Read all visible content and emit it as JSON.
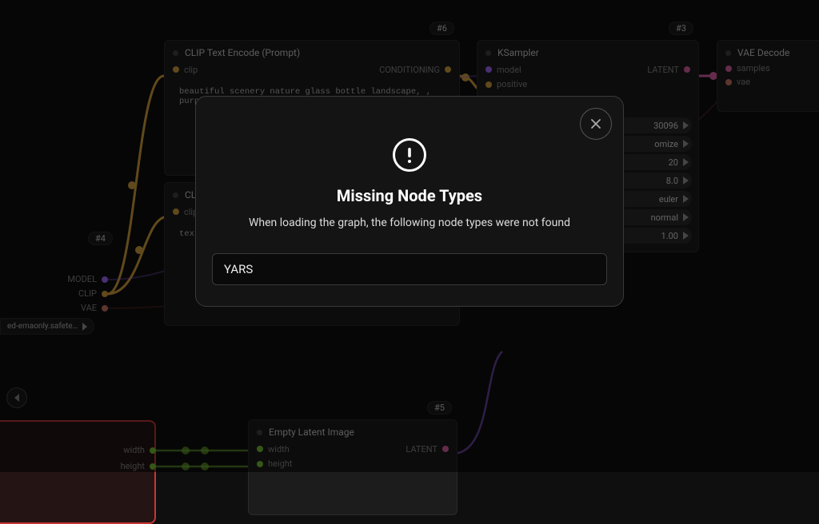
{
  "modal": {
    "title": "Missing Node Types",
    "subtitle": "When loading the graph, the following node types were not found",
    "entry": "YARS"
  },
  "nodes": {
    "clip1": {
      "id": "#6",
      "title": "CLIP Text Encode (Prompt)",
      "input_label": "clip",
      "output_label": "CONDITIONING",
      "text": "beautiful scenery nature glass bottle landscape, , purple galaxy bottle,"
    },
    "clip2": {
      "title": "CLIP Te",
      "input_label": "clip",
      "text": "text, waterm"
    },
    "ksampler": {
      "id": "#3",
      "title": "KSampler",
      "output_label": "LATENT",
      "in_model": "model",
      "in_positive": "positive",
      "params": {
        "seed_k": "",
        "seed_v": "30096",
        "ctrl_k": "",
        "ctrl_v": "omize",
        "steps_k": "",
        "steps_v": "20",
        "cfg_k": "",
        "cfg_v": "8.0",
        "sampler_k": "",
        "sampler_v": "euler",
        "sched_k": "",
        "sched_v": "normal",
        "denoise_k": "",
        "denoise_v": "1.00"
      }
    },
    "vae_decode": {
      "title": "VAE Decode",
      "in_samples": "samples",
      "in_vae": "vae"
    },
    "empty_latent": {
      "id": "#5",
      "title": "Empty Latent Image",
      "output_label": "LATENT",
      "in_width": "width",
      "in_height": "height"
    }
  },
  "float_ports": {
    "model": "MODEL",
    "clip": "CLIP",
    "vae": "VAE",
    "chip": "ed-emaonly.safete…",
    "n4_badge": "#4",
    "width": "width",
    "height": "height"
  }
}
